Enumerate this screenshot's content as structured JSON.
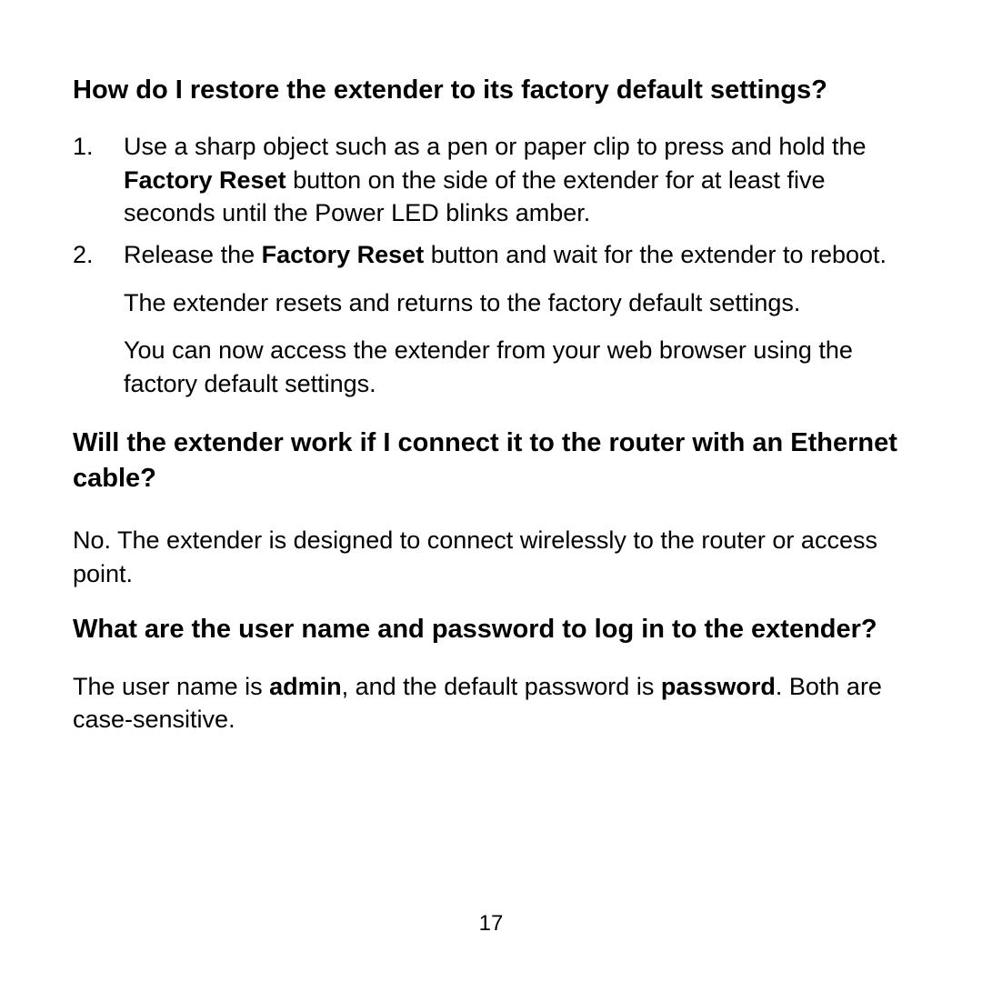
{
  "q1": {
    "heading": "How do I restore the extender to its factory default settings?",
    "step1_prefix": "Use a sharp object such as a pen or paper clip to press and hold the ",
    "step1_bold": "Factory Reset",
    "step1_suffix": " button on the side of the extender for at least five seconds until the Power LED blinks amber.",
    "step2_prefix": "Release the ",
    "step2_bold": "Factory Reset",
    "step2_suffix": " button and wait for the extender to reboot.",
    "step2_sub1": "The extender resets and returns to the factory default settings.",
    "step2_sub2": "You can now access the extender from your web browser using the factory default settings.",
    "num1": "1.",
    "num2": "2."
  },
  "q2": {
    "heading": "Will the extender work if I connect it to the router with an Ethernet cable?",
    "answer": "No. The extender is designed to connect wirelessly to the router or access point."
  },
  "q3": {
    "heading": "What are the user name and password to log in to the extender?",
    "answer_prefix": "The user name is ",
    "answer_bold1": "admin",
    "answer_mid": ", and the default password is ",
    "answer_bold2": "password",
    "answer_suffix": ". Both are case-sensitive."
  },
  "page_number": "17"
}
